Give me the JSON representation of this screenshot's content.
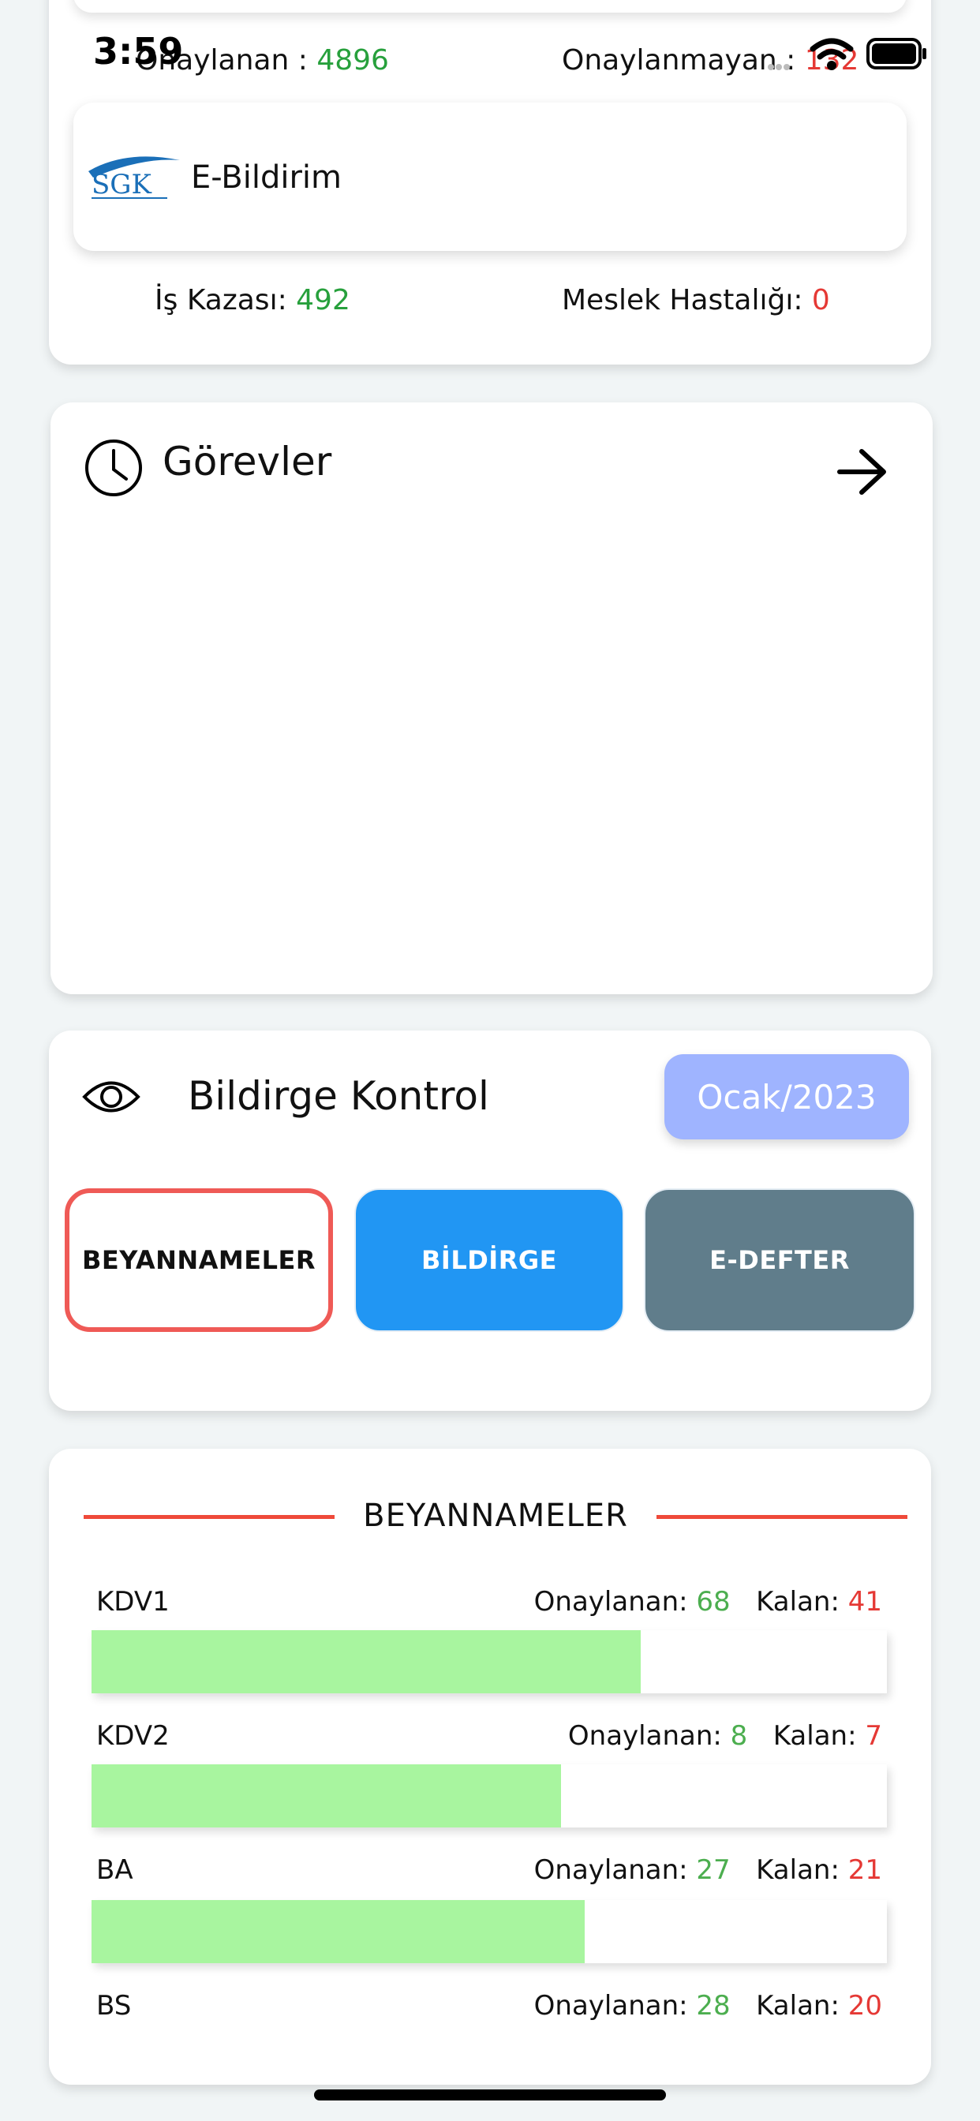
{
  "status_bar": {
    "time": "3:59"
  },
  "summary_card": {
    "approved_label": "Onaylanan :",
    "approved_value": "4896",
    "unapproved_label": "Onaylanmayan :",
    "unapproved_value": "132",
    "sgk_logo_text": "SGK",
    "ebildirim_label": "E-Bildirim",
    "work_accident_label": "İş Kazası:",
    "work_accident_value": "492",
    "occupational_disease_label": "Meslek Hastalığı:",
    "occupational_disease_value": "0"
  },
  "tasks": {
    "title": "Görevler"
  },
  "declaration_control": {
    "title": "Bildirge Kontrol",
    "period": "Ocak/2023",
    "tabs": [
      "BEYANNAMELER",
      "BİLDİRGE",
      "E-DEFTER"
    ],
    "active_tab": "BEYANNAMELER"
  },
  "declarations": {
    "title": "BEYANNAMELER",
    "approved_label": "Onaylanan:",
    "remaining_label": "Kalan:",
    "items": [
      {
        "name": "KDV1",
        "approved": "68",
        "remaining": "41",
        "progress": 0.69
      },
      {
        "name": "KDV2",
        "approved": "8",
        "remaining": "7",
        "progress": 0.59
      },
      {
        "name": "BA",
        "approved": "27",
        "remaining": "21",
        "progress": 0.62
      },
      {
        "name": "BS",
        "approved": "28",
        "remaining": "20"
      }
    ]
  },
  "colors": {
    "approved_green": "#27a03c",
    "remaining_red": "#e53935",
    "accent_red": "#ef4a3a",
    "period_button": "#9fb4ff",
    "tab_blue": "#2196f3",
    "tab_gray": "#607d8b",
    "progress_fill": "#a8f59f"
  }
}
